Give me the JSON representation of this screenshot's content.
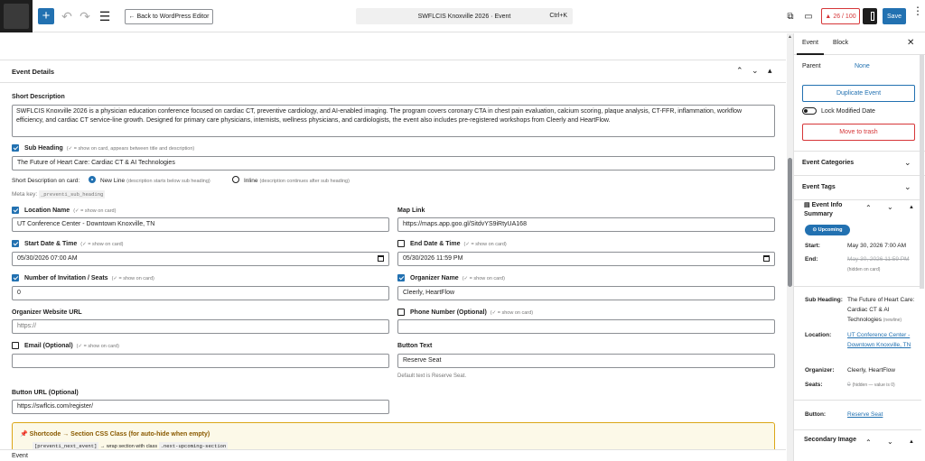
{
  "topbar": {
    "back_label": "← Back to WordPress Editor",
    "command_title": "SWFLCIS Knoxville 2026 · Event",
    "command_shortcut": "Ctrl+K",
    "count_badge": "26 / 100",
    "save_label": "Save",
    "colors": {
      "accent": "#2271b1",
      "danger": "#d63638"
    }
  },
  "panel": {
    "title": "Event Details"
  },
  "form": {
    "short_description_label": "Short Description",
    "short_description_value": "SWFLCIS Knoxville 2026 is a physician education conference focused on cardiac CT, preventive cardiology, and AI-enabled imaging. The program covers coronary CTA in chest pain evaluation, calcium scoring, plaque analysis, CT-FFR, inflammation, workflow efficiency, and cardiac CT service-line growth. Designed for primary care physicians, internists, wellness physicians, and cardiologists, the event also includes pre-registered workshops from Cleerly and HeartFlow.",
    "sub_heading_label": "Sub Heading",
    "sub_heading_hint": "(✓ = show on card, appears between title and description)",
    "sub_heading_value": "The Future of Heart Care: Cardiac CT & AI Technologies",
    "short_desc_on_card_label": "Short Description on card:",
    "new_line_label": "New Line",
    "new_line_hint": "(description starts below sub heading)",
    "inline_label": "Inline",
    "inline_hint": "(description continues after sub heading)",
    "meta_key_label": "Meta key:",
    "meta_key_value": "_preventi_sub_heading",
    "location_label": "Location Name",
    "show_on_card_hint": "(✓ = show on card)",
    "location_value": "UT Conference Center - Downtown Knoxville, TN",
    "map_link_label": "Map Link",
    "map_link_value": "https://maps.app.goo.gl/SitdvYS9iRtyUA168",
    "start_label": "Start Date & Time",
    "start_value": "05/30/2026 07:00 AM",
    "end_label": "End Date & Time",
    "end_value": "05/30/2026 11:59 PM",
    "seats_label": "Number of Invitation / Seats",
    "seats_value": "0",
    "organizer_label": "Organizer Name",
    "organizer_value": "Cleerly, HeartFlow",
    "organizer_url_label": "Organizer Website URL",
    "organizer_url_placeholder": "https://",
    "phone_label": "Phone Number (Optional)",
    "email_label": "Email (Optional)",
    "button_text_label": "Button Text",
    "button_text_value": "Reserve Seat",
    "button_text_help": "Default text is Reserve Seat.",
    "button_url_label": "Button URL (Optional)",
    "button_url_value": "https://swflcis.com/register/"
  },
  "notice": {
    "title": "Shortcode → Section CSS Class (for auto-hide when empty)",
    "shortcode": "[preventi_next_event]",
    "arrow_text": "→ wrap section with class",
    "class_name": ".next-upcoming-section"
  },
  "sidebar": {
    "tab_event": "Event",
    "tab_block": "Block",
    "parent_label": "Parent",
    "parent_value": "None",
    "duplicate_label": "Duplicate Event",
    "lock_label": "Lock Modified Date",
    "trash_label": "Move to trash",
    "categories_label": "Event Categories",
    "tags_label": "Event Tags",
    "summary_title": "Event Info Summary",
    "status_badge": "Upcoming",
    "start_key": "Start:",
    "start_val": "May 30, 2026 7:00 AM",
    "end_key": "End:",
    "end_val": "May 30, 2026 11:59 PM",
    "end_note": "(hidden on card)",
    "subheading_key": "Sub Heading:",
    "subheading_val": "The Future of Heart Care: Cardiac CT & AI Technologies",
    "subheading_note": "(newline)",
    "location_key": "Location:",
    "location_val": "UT Conference Center - Downtown Knoxville, TN",
    "organizer_key": "Organizer:",
    "organizer_val": "Cleerly, HeartFlow",
    "seats_key": "Seats:",
    "seats_val": "0",
    "seats_note": "(hidden — value is 0)",
    "button_key": "Button:",
    "button_val": "Reserve Seat",
    "secondary_label": "Secondary Image"
  },
  "footer": {
    "breadcrumb": "Event"
  }
}
